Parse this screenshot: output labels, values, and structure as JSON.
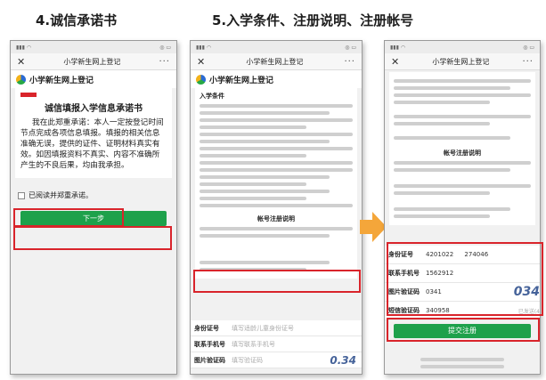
{
  "headings": {
    "left": "4.诚信承诺书",
    "right": "5.入学条件、注册说明、注册帐号"
  },
  "app": {
    "title": "小学新生网上登记",
    "brand": "小学新生网上登记",
    "status_time_1": "",
    "status_time_2": "",
    "status_time_3": ""
  },
  "phone1": {
    "pledge_title": "诚信填报入学信息承诺书",
    "pledge_text": "我在此郑重承诺：本人一定按登记时间节点完成各项信息填报。填报的相关信息准确无误，提供的证件、证明材料真实有效。如因填报资料不真实、内容不准确所产生的不良后果，均由我承担。",
    "agree_text": "已阅读并郑重承诺。",
    "next_button": "下一步",
    "footer_1": "",
    "footer_2": ""
  },
  "phone2": {
    "section_title": "入学条件",
    "notes_title": "帐号注册说明",
    "form": {
      "id_label": "身份证号",
      "id_placeholder": "填写适龄儿童身份证号",
      "phone_label": "联系手机号",
      "phone_placeholder": "填写联系手机号",
      "captcha_label": "图片验证码",
      "captcha_placeholder": "填写验证码",
      "captcha_text": "0.34"
    }
  },
  "phone3": {
    "notes_title": "帐号注册说明",
    "form": {
      "id_label": "身份证号",
      "id_value": "4201022",
      "id_value_tail": "274046",
      "phone_label": "联系手机号",
      "phone_value": "1562912",
      "captcha_label": "图片验证码",
      "captcha_value": "0341",
      "captcha_text": "034",
      "sms_label": "短信验证码",
      "sms_value": "340958",
      "sms_status": "已发送(4"
    },
    "submit_button": "提交注册"
  },
  "colors": {
    "green": "#1ea14b",
    "red_highlight": "#d9242b",
    "arrow": "#f4a63a"
  }
}
